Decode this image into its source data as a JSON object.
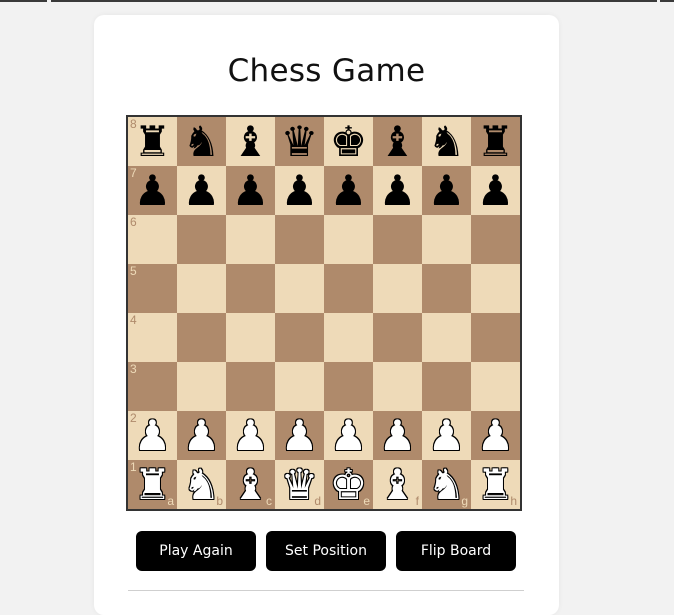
{
  "page": {
    "title": "Chess Game"
  },
  "buttons": {
    "play_again": "Play Again",
    "set_position": "Set Position",
    "flip_board": "Flip Board"
  },
  "board": {
    "colors": {
      "light": "#eedab8",
      "dark": "#af8a6b"
    },
    "files": [
      "a",
      "b",
      "c",
      "d",
      "e",
      "f",
      "g",
      "h"
    ],
    "ranks": [
      "8",
      "7",
      "6",
      "5",
      "4",
      "3",
      "2",
      "1"
    ],
    "pieces": [
      [
        "br",
        "bn",
        "bb",
        "bq",
        "bk",
        "bb",
        "bn",
        "br"
      ],
      [
        "bp",
        "bp",
        "bp",
        "bp",
        "bp",
        "bp",
        "bp",
        "bp"
      ],
      [
        "",
        "",
        "",
        "",
        "",
        "",
        "",
        ""
      ],
      [
        "",
        "",
        "",
        "",
        "",
        "",
        "",
        ""
      ],
      [
        "",
        "",
        "",
        "",
        "",
        "",
        "",
        ""
      ],
      [
        "",
        "",
        "",
        "",
        "",
        "",
        "",
        ""
      ],
      [
        "wp",
        "wp",
        "wp",
        "wp",
        "wp",
        "wp",
        "wp",
        "wp"
      ],
      [
        "wr",
        "wn",
        "wb",
        "wq",
        "wk",
        "wb",
        "wn",
        "wr"
      ]
    ]
  }
}
